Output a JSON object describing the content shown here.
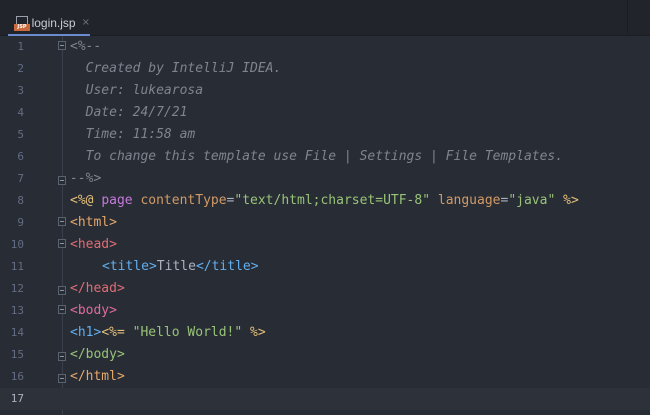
{
  "tab": {
    "filename": "login.jsp",
    "icon_badge": "JSP",
    "close": "×"
  },
  "editor": {
    "line_numbers": [
      "1",
      "2",
      "3",
      "4",
      "5",
      "6",
      "7",
      "8",
      "9",
      "10",
      "11",
      "12",
      "13",
      "14",
      "15",
      "16",
      "17"
    ],
    "comment": {
      "open": "<%--",
      "created": "  Created by IntelliJ IDEA.",
      "user": "  User: lukearosa",
      "date": "  Date: 24/7/21",
      "time": "  Time: 11:58 am",
      "template": "  To change this template use File | Settings | File Templates.",
      "close": "--%>"
    },
    "directive": {
      "open": "<%@ ",
      "keyword": "page",
      "attr1": "contentType",
      "eq1": "=",
      "val1": "\"text/html;charset=UTF-8\"",
      "attr2": "language",
      "eq2": "=",
      "val2": "\"java\"",
      "close": "%>"
    },
    "html_open": "<html>",
    "head_open": "<head>",
    "title_open": "<title>",
    "title_text": "Title",
    "title_close": "</title>",
    "head_close": "</head>",
    "body_open": "<body>",
    "h1_open": "<h1>",
    "expr_open": "<%=",
    "expr_value": "\"Hello World!\"",
    "expr_close": "%>",
    "body_close": "</body>",
    "html_close": "</html>"
  }
}
